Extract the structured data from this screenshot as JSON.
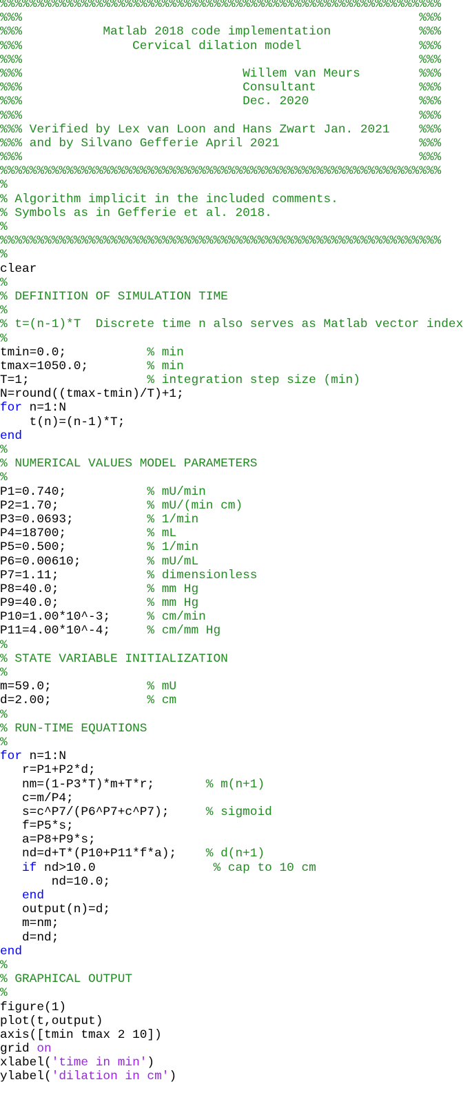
{
  "document": {
    "language": "Matlab",
    "colors": {
      "comment": "#228B22",
      "keyword": "#0000FF",
      "string": "#A020F0",
      "code": "#000000"
    },
    "lines": [
      [
        {
          "t": "comment",
          "s": "%%%%%%%%%%%%%%%%%%%%%%%%%%%%%%%%%%%%%%%%%%%%%%%%%%%%%%%%%%%%"
        }
      ],
      [
        {
          "t": "comment",
          "s": "%%%                                                      %%%"
        }
      ],
      [
        {
          "t": "comment",
          "s": "%%%           Matlab 2018 code implementation            %%%"
        }
      ],
      [
        {
          "t": "comment",
          "s": "%%%               Cervical dilation model                %%%"
        }
      ],
      [
        {
          "t": "comment",
          "s": "%%%                                                      %%%"
        }
      ],
      [
        {
          "t": "comment",
          "s": "%%%                              Willem van Meurs        %%%"
        }
      ],
      [
        {
          "t": "comment",
          "s": "%%%                              Consultant              %%%"
        }
      ],
      [
        {
          "t": "comment",
          "s": "%%%                              Dec. 2020               %%%"
        }
      ],
      [
        {
          "t": "comment",
          "s": "%%%                                                      %%%"
        }
      ],
      [
        {
          "t": "comment",
          "s": "%%% Verified by Lex van Loon and Hans Zwart Jan. 2021    %%%"
        }
      ],
      [
        {
          "t": "comment",
          "s": "%%% and by Silvano Gefferie April 2021                   %%%"
        }
      ],
      [
        {
          "t": "comment",
          "s": "%%%                                                      %%%"
        }
      ],
      [
        {
          "t": "comment",
          "s": "%%%%%%%%%%%%%%%%%%%%%%%%%%%%%%%%%%%%%%%%%%%%%%%%%%%%%%%%%%%%"
        }
      ],
      [
        {
          "t": "comment",
          "s": "%"
        }
      ],
      [
        {
          "t": "comment",
          "s": "% Algorithm implicit in the included comments."
        }
      ],
      [
        {
          "t": "comment",
          "s": "% Symbols as in Gefferie et al. 2018."
        }
      ],
      [
        {
          "t": "comment",
          "s": "%"
        }
      ],
      [
        {
          "t": "comment",
          "s": "%%%%%%%%%%%%%%%%%%%%%%%%%%%%%%%%%%%%%%%%%%%%%%%%%%%%%%%%%%%%"
        }
      ],
      [
        {
          "t": "comment",
          "s": "%"
        }
      ],
      [
        {
          "t": "code",
          "s": "clear"
        }
      ],
      [
        {
          "t": "comment",
          "s": "%"
        }
      ],
      [
        {
          "t": "comment",
          "s": "% DEFINITION OF SIMULATION TIME"
        }
      ],
      [
        {
          "t": "comment",
          "s": "%"
        }
      ],
      [
        {
          "t": "comment",
          "s": "% t=(n-1)*T  Discrete time n also serves as Matlab vector index"
        }
      ],
      [
        {
          "t": "comment",
          "s": "%"
        }
      ],
      [
        {
          "t": "code",
          "s": "tmin=0.0;           "
        },
        {
          "t": "comment",
          "s": "% min"
        }
      ],
      [
        {
          "t": "code",
          "s": "tmax=1050.0;        "
        },
        {
          "t": "comment",
          "s": "% min"
        }
      ],
      [
        {
          "t": "code",
          "s": "T=1;                "
        },
        {
          "t": "comment",
          "s": "% integration step size (min)"
        }
      ],
      [
        {
          "t": "code",
          "s": "N=round((tmax-tmin)/T)+1;"
        }
      ],
      [
        {
          "t": "keyword",
          "s": "for"
        },
        {
          "t": "code",
          "s": " n=1:N"
        }
      ],
      [
        {
          "t": "code",
          "s": "    t(n)=(n-1)*T;"
        }
      ],
      [
        {
          "t": "keyword",
          "s": "end"
        }
      ],
      [
        {
          "t": "comment",
          "s": "%"
        }
      ],
      [
        {
          "t": "comment",
          "s": "% NUMERICAL VALUES MODEL PARAMETERS"
        }
      ],
      [
        {
          "t": "comment",
          "s": "%"
        }
      ],
      [
        {
          "t": "code",
          "s": "P1=0.740;           "
        },
        {
          "t": "comment",
          "s": "% mU/min"
        }
      ],
      [
        {
          "t": "code",
          "s": "P2=1.70;            "
        },
        {
          "t": "comment",
          "s": "% mU/(min cm)"
        }
      ],
      [
        {
          "t": "code",
          "s": "P3=0.0693;          "
        },
        {
          "t": "comment",
          "s": "% 1/min"
        }
      ],
      [
        {
          "t": "code",
          "s": "P4=18700;           "
        },
        {
          "t": "comment",
          "s": "% mL"
        }
      ],
      [
        {
          "t": "code",
          "s": "P5=0.500;           "
        },
        {
          "t": "comment",
          "s": "% 1/min"
        }
      ],
      [
        {
          "t": "code",
          "s": "P6=0.00610;         "
        },
        {
          "t": "comment",
          "s": "% mU/mL"
        }
      ],
      [
        {
          "t": "code",
          "s": "P7=1.11;            "
        },
        {
          "t": "comment",
          "s": "% dimensionless"
        }
      ],
      [
        {
          "t": "code",
          "s": "P8=40.0;            "
        },
        {
          "t": "comment",
          "s": "% mm Hg"
        }
      ],
      [
        {
          "t": "code",
          "s": "P9=40.0;            "
        },
        {
          "t": "comment",
          "s": "% mm Hg"
        }
      ],
      [
        {
          "t": "code",
          "s": "P10=1.00*10^-3;     "
        },
        {
          "t": "comment",
          "s": "% cm/min"
        }
      ],
      [
        {
          "t": "code",
          "s": "P11=4.00*10^-4;     "
        },
        {
          "t": "comment",
          "s": "% cm/mm Hg"
        }
      ],
      [
        {
          "t": "comment",
          "s": "%"
        }
      ],
      [
        {
          "t": "comment",
          "s": "% STATE VARIABLE INITIALIZATION"
        }
      ],
      [
        {
          "t": "comment",
          "s": "%"
        }
      ],
      [
        {
          "t": "code",
          "s": "m=59.0;             "
        },
        {
          "t": "comment",
          "s": "% mU"
        }
      ],
      [
        {
          "t": "code",
          "s": "d=2.00;             "
        },
        {
          "t": "comment",
          "s": "% cm"
        }
      ],
      [
        {
          "t": "comment",
          "s": "%"
        }
      ],
      [
        {
          "t": "comment",
          "s": "% RUN-TIME EQUATIONS"
        }
      ],
      [
        {
          "t": "comment",
          "s": "%"
        }
      ],
      [
        {
          "t": "keyword",
          "s": "for"
        },
        {
          "t": "code",
          "s": " n=1:N"
        }
      ],
      [
        {
          "t": "code",
          "s": "   r=P1+P2*d;"
        }
      ],
      [
        {
          "t": "code",
          "s": "   nm=(1-P3*T)*m+T*r;       "
        },
        {
          "t": "comment",
          "s": "% m(n+1)"
        }
      ],
      [
        {
          "t": "code",
          "s": "   c=m/P4;"
        }
      ],
      [
        {
          "t": "code",
          "s": "   s=c^P7/(P6^P7+c^P7);     "
        },
        {
          "t": "comment",
          "s": "% sigmoid"
        }
      ],
      [
        {
          "t": "code",
          "s": "   f=P5*s;"
        }
      ],
      [
        {
          "t": "code",
          "s": "   a=P8+P9*s;"
        }
      ],
      [
        {
          "t": "code",
          "s": "   nd=d+T*(P10+P11*f*a);    "
        },
        {
          "t": "comment",
          "s": "% d(n+1)"
        }
      ],
      [
        {
          "t": "code",
          "s": "   "
        },
        {
          "t": "keyword",
          "s": "if"
        },
        {
          "t": "code",
          "s": " nd>10.0                "
        },
        {
          "t": "comment",
          "s": "% cap to 10 cm"
        }
      ],
      [
        {
          "t": "code",
          "s": "       nd=10.0;"
        }
      ],
      [
        {
          "t": "code",
          "s": "   "
        },
        {
          "t": "keyword",
          "s": "end"
        }
      ],
      [
        {
          "t": "code",
          "s": "   output(n)=d;"
        }
      ],
      [
        {
          "t": "code",
          "s": "   m=nm;"
        }
      ],
      [
        {
          "t": "code",
          "s": "   d=nd;"
        }
      ],
      [
        {
          "t": "keyword",
          "s": "end"
        }
      ],
      [
        {
          "t": "comment",
          "s": "%"
        }
      ],
      [
        {
          "t": "comment",
          "s": "% GRAPHICAL OUTPUT"
        }
      ],
      [
        {
          "t": "comment",
          "s": "%"
        }
      ],
      [
        {
          "t": "code",
          "s": "figure(1)"
        }
      ],
      [
        {
          "t": "code",
          "s": "plot(t,output)"
        }
      ],
      [
        {
          "t": "code",
          "s": "axis([tmin tmax 2 10])"
        }
      ],
      [
        {
          "t": "code",
          "s": "grid "
        },
        {
          "t": "string",
          "s": "on"
        }
      ],
      [
        {
          "t": "code",
          "s": "xlabel("
        },
        {
          "t": "string",
          "s": "'time in min'"
        },
        {
          "t": "code",
          "s": ")"
        }
      ],
      [
        {
          "t": "code",
          "s": "ylabel("
        },
        {
          "t": "string",
          "s": "'dilation in cm'"
        },
        {
          "t": "code",
          "s": ")"
        }
      ]
    ]
  }
}
